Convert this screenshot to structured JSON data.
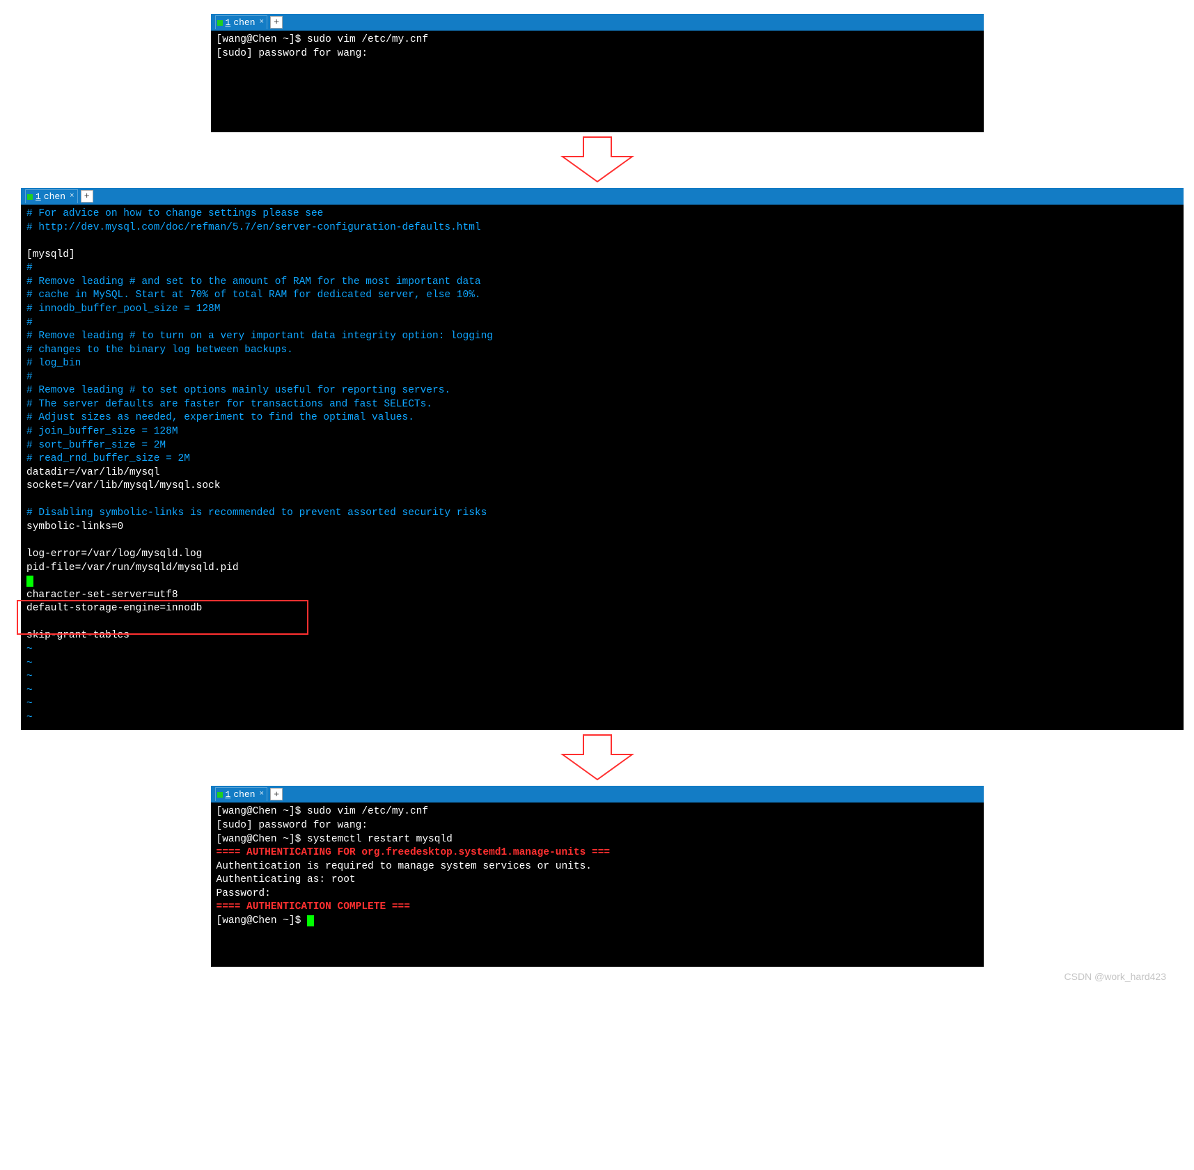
{
  "tab": {
    "prefix": "1",
    "label": "chen",
    "close": "×",
    "plus": "+"
  },
  "term1": {
    "line1_prompt": "[wang@Chen ~]$ ",
    "line1_cmd": "sudo vim /etc/my.cnf",
    "line2": "[sudo] password for wang:"
  },
  "term2": {
    "c1": "# For advice on how to change settings please see",
    "c2": "# http://dev.mysql.com/doc/refman/5.7/en/server-configuration-defaults.html",
    "blank": "",
    "mysqld": "[mysqld]",
    "h": "#",
    "c3": "# Remove leading # and set to the amount of RAM for the most important data",
    "c4": "# cache in MySQL. Start at 70% of total RAM for dedicated server, else 10%.",
    "c5": "# innodb_buffer_pool_size = 128M",
    "c6": "# Remove leading # to turn on a very important data integrity option: logging",
    "c7": "# changes to the binary log between backups.",
    "c8": "# log_bin",
    "c9": "# Remove leading # to set options mainly useful for reporting servers.",
    "c10": "# The server defaults are faster for transactions and fast SELECTs.",
    "c11": "# Adjust sizes as needed, experiment to find the optimal values.",
    "c12": "# join_buffer_size = 128M",
    "c13": "# sort_buffer_size = 2M",
    "c14": "# read_rnd_buffer_size = 2M",
    "w1": "datadir=/var/lib/mysql",
    "w2": "socket=/var/lib/mysql/mysql.sock",
    "c15": "# Disabling symbolic-links is recommended to prevent assorted security risks",
    "w3": "symbolic-links=0",
    "w4": "log-error=/var/log/mysqld.log",
    "w5": "pid-file=/var/run/mysqld/mysqld.pid",
    "w6": "character-set-server=utf8",
    "w7": "default-storage-engine=innodb",
    "w8": "skip-grant-tables",
    "tilde": "~"
  },
  "term3": {
    "l1_prompt": "[wang@Chen ~]$ ",
    "l1_cmd": "sudo vim /etc/my.cnf",
    "l2": "[sudo] password for wang:",
    "l3_prompt": "[wang@Chen ~]$ ",
    "l3_cmd": "systemctl restart mysqld",
    "l4": "==== AUTHENTICATING FOR org.freedesktop.systemd1.manage-units ===",
    "l5": "Authentication is required to manage system services or units.",
    "l6": "Authenticating as: root",
    "l7": "Password: ",
    "l8": "==== AUTHENTICATION COMPLETE ===",
    "l9_prompt": "[wang@Chen ~]$ "
  },
  "watermark": "CSDN @work_hard423"
}
